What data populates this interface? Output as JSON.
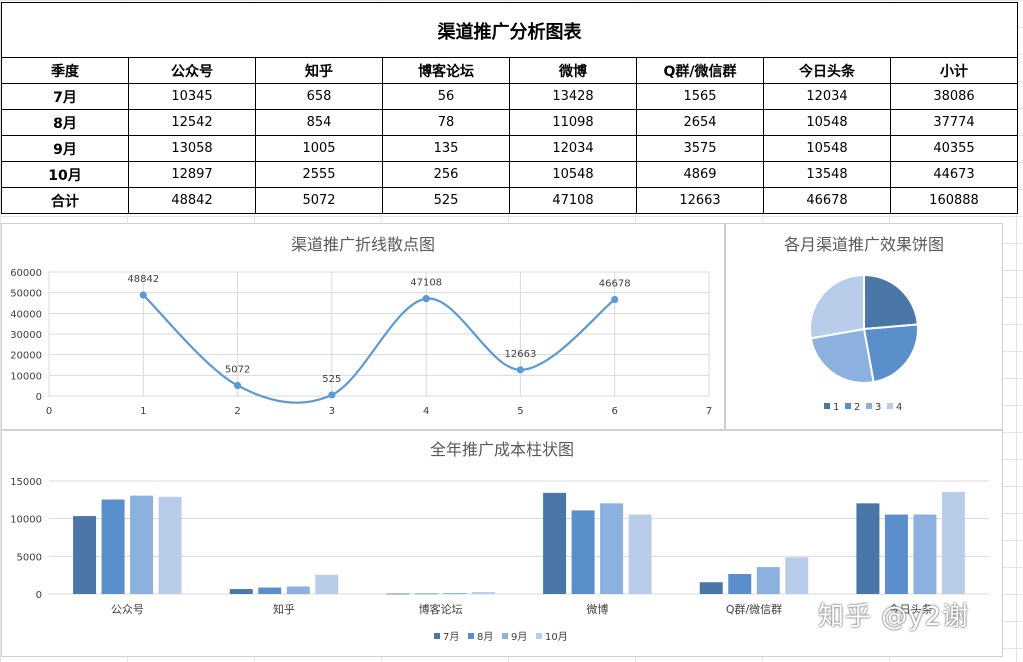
{
  "title": "渠道推广分析图表",
  "table": {
    "headers": [
      "季度",
      "公众号",
      "知乎",
      "博客论坛",
      "微博",
      "Q群/微信群",
      "今日头条",
      "小计"
    ],
    "rows": [
      [
        "7月",
        "10345",
        "658",
        "56",
        "13428",
        "1565",
        "12034",
        "38086"
      ],
      [
        "8月",
        "12542",
        "854",
        "78",
        "11098",
        "2654",
        "10548",
        "37774"
      ],
      [
        "9月",
        "13058",
        "1005",
        "135",
        "12034",
        "3575",
        "10548",
        "40355"
      ],
      [
        "10月",
        "12897",
        "2555",
        "256",
        "10548",
        "4869",
        "13548",
        "44673"
      ],
      [
        "合计",
        "48842",
        "5072",
        "525",
        "47108",
        "12663",
        "46678",
        "160888"
      ]
    ]
  },
  "chart_data": [
    {
      "type": "scatter",
      "title": "渠道推广折线散点图",
      "x": [
        1,
        2,
        3,
        4,
        5,
        6
      ],
      "y": [
        48842,
        5072,
        525,
        47108,
        12663,
        46678
      ],
      "xlim": [
        0,
        7
      ],
      "ylim": [
        0,
        60000
      ],
      "xticks": [
        0,
        1,
        2,
        3,
        4,
        5,
        6,
        7
      ],
      "yticks": [
        0,
        10000,
        20000,
        30000,
        40000,
        50000,
        60000
      ],
      "smooth": true,
      "grid": true,
      "color": "#5b9bd5"
    },
    {
      "type": "pie",
      "title": "各月渠道推广效果饼图",
      "labels": [
        "1",
        "2",
        "3",
        "4"
      ],
      "values": [
        38086,
        37774,
        40355,
        44673
      ],
      "colors": [
        "#4a77a8",
        "#5b8fcb",
        "#8db1df",
        "#b9cdea"
      ],
      "legend": "bottom"
    },
    {
      "type": "bar",
      "title": "全年推广成本柱状图",
      "categories": [
        "公众号",
        "知乎",
        "博客论坛",
        "微博",
        "Q群/微信群",
        "今日头条"
      ],
      "series": [
        {
          "name": "7月",
          "values": [
            10345,
            658,
            56,
            13428,
            1565,
            12034
          ]
        },
        {
          "name": "8月",
          "values": [
            12542,
            854,
            78,
            11098,
            2654,
            10548
          ]
        },
        {
          "name": "9月",
          "values": [
            13058,
            1005,
            135,
            12034,
            3575,
            10548
          ]
        },
        {
          "name": "10月",
          "values": [
            12897,
            2555,
            256,
            10548,
            4869,
            13548
          ]
        }
      ],
      "colors": [
        "#4a77a8",
        "#5b8fcb",
        "#8db1df",
        "#b9cdea"
      ],
      "ylim": [
        0,
        15000
      ],
      "yticks": [
        0,
        5000,
        10000,
        15000
      ],
      "grid": true,
      "legend": "bottom"
    }
  ],
  "watermark": "知乎 @y2谢"
}
